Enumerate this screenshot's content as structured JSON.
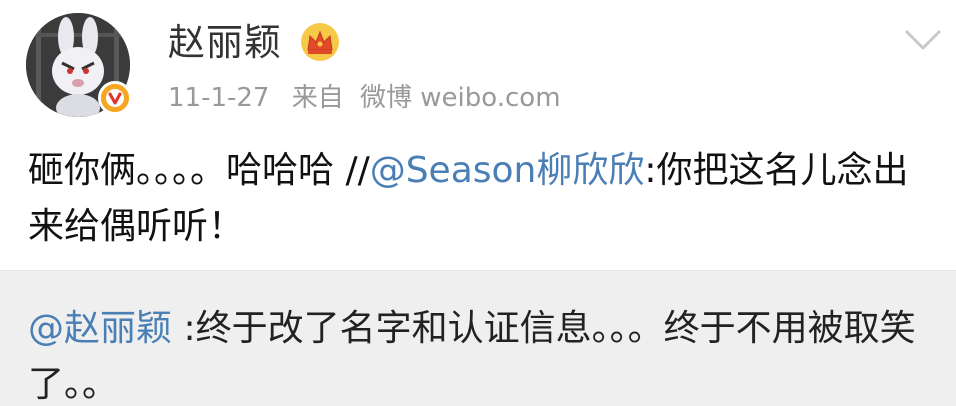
{
  "post": {
    "username": "赵丽颖",
    "date": "11-1-27",
    "source_prefix": "来自",
    "source_name": "微博 weibo.com",
    "text_main": "砸你俩。。。。哈哈哈 //",
    "mention_1": "@Season柳欣欣",
    "text_after_mention": ":你把这名儿念出来给偶听听！"
  },
  "retweet": {
    "mention": "@赵丽颖",
    "text": " :终于改了名字和认证信息。。。终于不用被取笑了。。"
  },
  "icons": {
    "crown": "crown-icon",
    "verified": "verified-badge-icon",
    "chevron": "chevron-down-icon"
  },
  "colors": {
    "link": "#4a7fb5",
    "badge": "#f5a623",
    "crown": "#f0a81b",
    "retweet_bg": "#efefef"
  }
}
